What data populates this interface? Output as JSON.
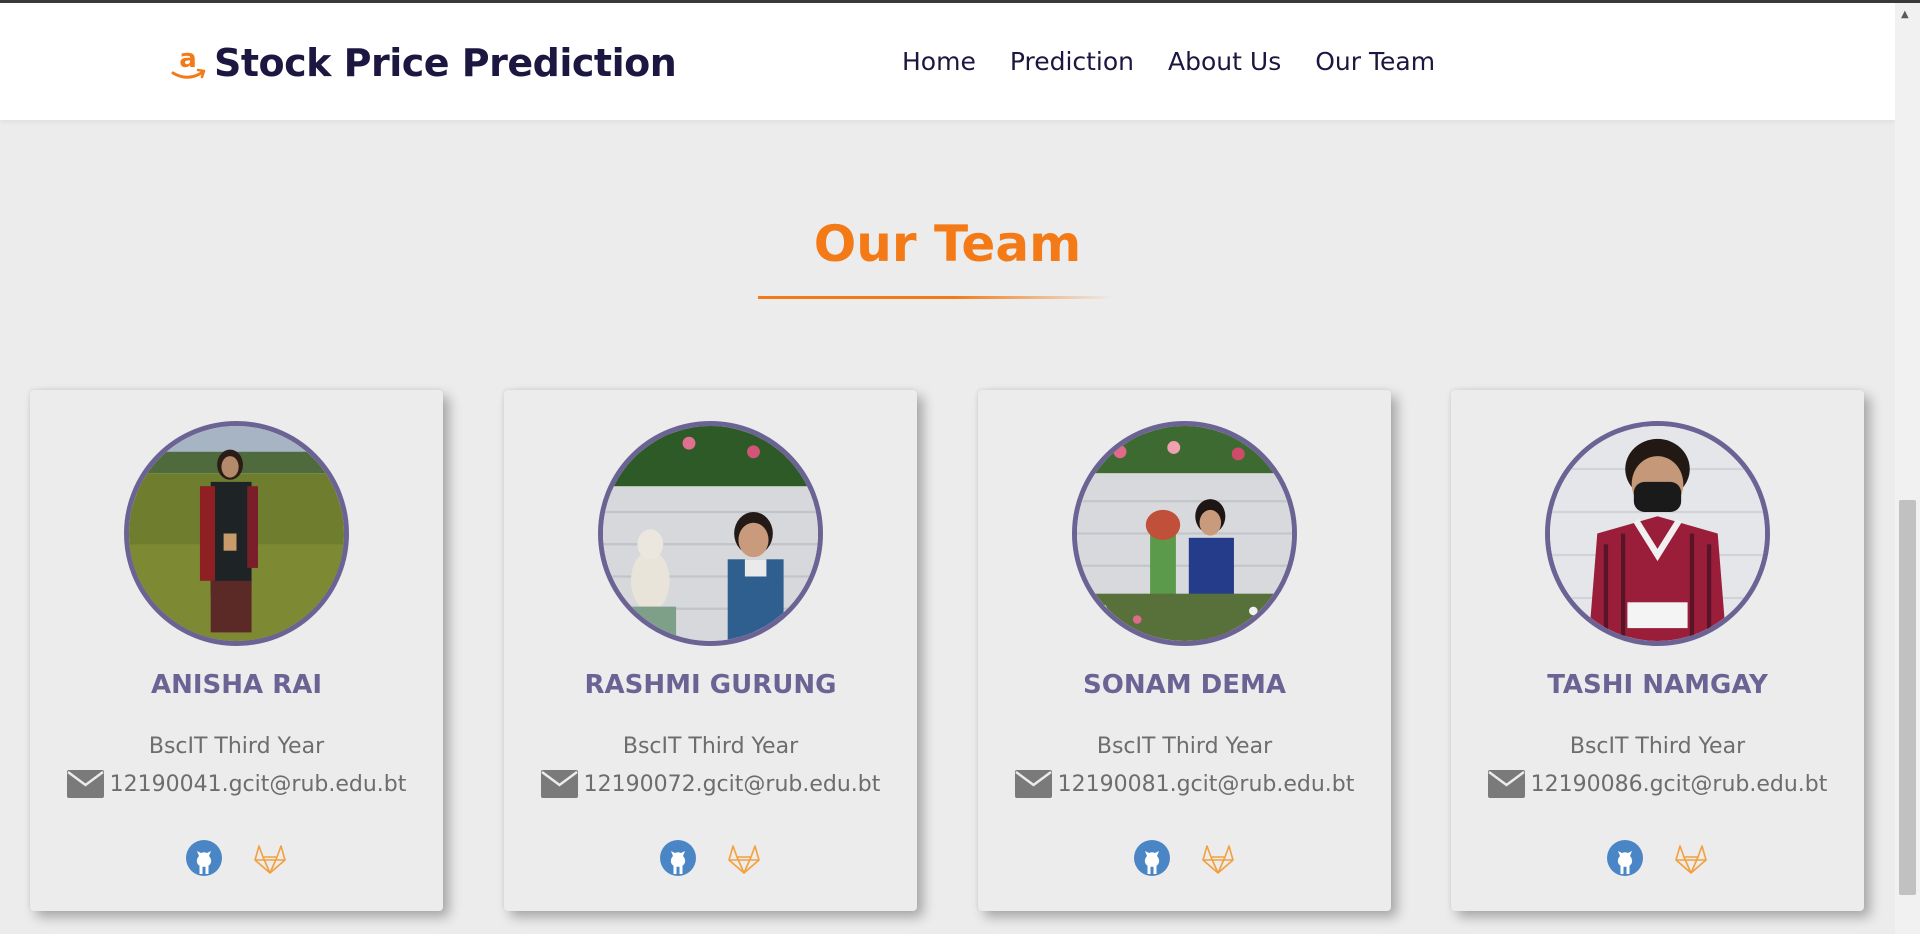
{
  "navbar": {
    "brand_logo_icon": "amazon-a-icon",
    "brand_title": "Stock Price Prediction",
    "links": [
      {
        "label": "Home"
      },
      {
        "label": "Prediction"
      },
      {
        "label": "About Us"
      },
      {
        "label": "Our Team"
      }
    ]
  },
  "section": {
    "title": "Our Team"
  },
  "members": [
    {
      "name": "ANISHA RAI",
      "role": "BscIT Third Year",
      "email": "12190041.gcit@rub.edu.bt"
    },
    {
      "name": "RASHMI GURUNG",
      "role": "BscIT Third Year",
      "email": "12190072.gcit@rub.edu.bt"
    },
    {
      "name": "SONAM DEMA",
      "role": "BscIT Third Year",
      "email": "12190081.gcit@rub.edu.bt"
    },
    {
      "name": "TASHI NAMGAY",
      "role": "BscIT Third Year",
      "email": "12190086.gcit@rub.edu.bt"
    }
  ],
  "icons": {
    "email": "envelope-icon",
    "github": "github-icon",
    "gitlab": "gitlab-icon"
  },
  "colors": {
    "accent_orange": "#f37a16",
    "brand_navy": "#1b1740",
    "member_purple": "#6c6395",
    "muted_text": "#6d6d6d",
    "github_blue": "#4a86c5",
    "gitlab_orange": "#f2a03d"
  }
}
